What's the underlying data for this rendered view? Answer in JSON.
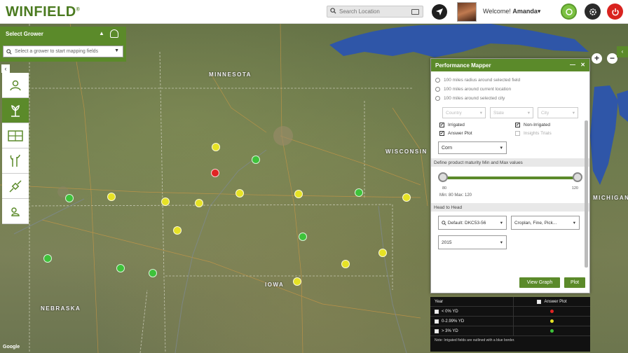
{
  "header": {
    "logo": "WINFIELD",
    "logo_mark": "®",
    "search_placeholder": "Search Location",
    "welcome_prefix": "Welcome! ",
    "user_name": "Amanda",
    "user_caret": "▾"
  },
  "left_panel": {
    "title": "Select Grower",
    "caret": "▲",
    "grower_placeholder": "Select a grower to start mapping fields",
    "collapse": "‹"
  },
  "map": {
    "labels": [
      "MINNESOTA",
      "WISCONSIN",
      "IOWA",
      "NEBRASKA",
      "MICHIGAN"
    ],
    "markers": [
      {
        "color": "yellow"
      },
      {
        "color": "green"
      },
      {
        "color": "red"
      },
      {
        "color": "yellow"
      },
      {
        "color": "yellow"
      },
      {
        "color": "green"
      },
      {
        "color": "yellow"
      },
      {
        "color": "yellow"
      },
      {
        "color": "green"
      },
      {
        "color": "yellow"
      },
      {
        "color": "yellow"
      },
      {
        "color": "yellow"
      },
      {
        "color": "green"
      },
      {
        "color": "green"
      },
      {
        "color": "green"
      },
      {
        "color": "green"
      },
      {
        "color": "yellow"
      },
      {
        "color": "yellow"
      },
      {
        "color": "yellow"
      },
      {
        "color": "yellow"
      }
    ],
    "zoom_in": "+",
    "zoom_out": "−",
    "google": "Google"
  },
  "performance_mapper": {
    "title": "Performance Mapper",
    "minimize": "—",
    "close": "✕",
    "radios": [
      "100 miles radius around selected field",
      "100 miles around current location",
      "100 miles around selected city"
    ],
    "ghost_selects": [
      "Country",
      "State",
      "City"
    ],
    "checkboxes": [
      {
        "label": "Irrigated",
        "checked": true
      },
      {
        "label": "Non-Irrigated",
        "checked": true
      },
      {
        "label": "Answer Plot",
        "checked": true
      },
      {
        "label": "Insights Trials",
        "checked": false
      }
    ],
    "crop": "Corn",
    "section_label": "Define product maturity Min and Max values",
    "slider_min_label": "80",
    "slider_max_label": "120",
    "minmax": "Min: 80 Max: 120",
    "head_to_head": "Head to Head",
    "product_select": "Default: DKC53-56",
    "compare_select": "Croplan, Fine, Pick...",
    "year_select": "2015",
    "btn_view_graph": "View Graph",
    "btn_plot": "Plot"
  },
  "legend": {
    "col1_header": "Year",
    "col2_header": "Answer Plot",
    "rows": [
      {
        "label": "< 0% YD",
        "dot": "#e02424"
      },
      {
        "label": "0-2.99% YD",
        "dot": "#e6e225"
      },
      {
        "label": "> 3% YD",
        "dot": "#3ec23a"
      }
    ],
    "note": "Note: Irrigated fields are outlined with a blue border."
  },
  "colors": {
    "brand_green": "#5b8a2a",
    "marker_yellow": "#e6e225",
    "marker_green": "#3ec23a",
    "marker_red": "#e02424"
  }
}
